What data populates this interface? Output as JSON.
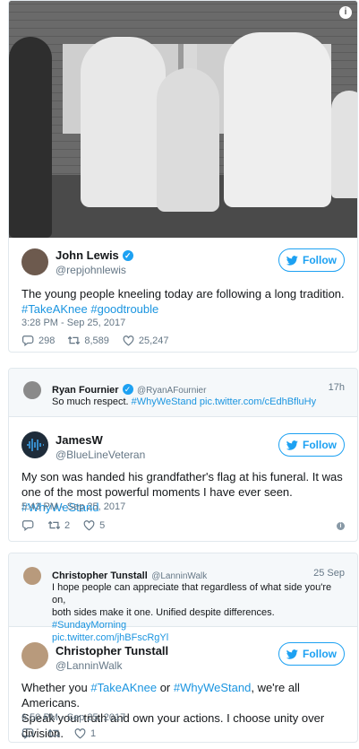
{
  "colors": {
    "accent": "#1da1f2",
    "link": "#1b95e0",
    "muted": "#657786",
    "border": "#e1e8ed"
  },
  "embed1": {
    "author": {
      "name": "John Lewis",
      "handle": "@repjohnlewis",
      "verified": true
    },
    "follow_label": "Follow",
    "text_before": "The young people kneeling today are following a long tradition.",
    "hashtags": [
      "#TakeAKnee",
      "#goodtrouble"
    ],
    "timestamp": "3:28 PM - Sep 25, 2017",
    "stats": {
      "replies": "298",
      "retweets": "8,589",
      "likes": "25,247"
    }
  },
  "embed2": {
    "quoted": {
      "author": {
        "name": "Ryan Fournier",
        "handle": "@RyanAFournier",
        "verified": true
      },
      "time": "17h",
      "text": "So much respect.",
      "hashtag": "#WhyWeStand",
      "link": "pic.twitter.com/cEdhBfluHy"
    },
    "author": {
      "name": "JamesW",
      "handle": "@BlueLineVeteran"
    },
    "follow_label": "Follow",
    "text_before": "My son was handed his grandfather's flag at his funeral. It was one of the most powerful moments I have ever seen.",
    "hashtag": "#WhyWeStand",
    "timestamp": "5:43 PM - Sep 25, 2017",
    "stats": {
      "retweets": "2",
      "likes": "5"
    }
  },
  "embed3": {
    "quoted": {
      "author": {
        "name": "Christopher Tunstall",
        "handle": "@LanninWalk"
      },
      "time": "25 Sep",
      "text_line1": "I hope people can appreciate that regardless of what side you're on,",
      "text_line2a": "both sides make it one. Unified despite differences.",
      "hashtag": "#SundayMorning",
      "link": "pic.twitter.com/jhBFscRgYl"
    },
    "author": {
      "name": "Christopher Tunstall",
      "handle": "@LanninWalk"
    },
    "follow_label": "Follow",
    "text_a": "Whether you",
    "hashtag1": "#TakeAKnee",
    "text_b": "or",
    "hashtag2": "#WhyWeStand",
    "text_c": ", we're all Americans.",
    "text_line2": "Speak your truth and own your actions. I choose unity over division.",
    "timestamp": "6:50 PM - Sep 25, 2017",
    "stats": {
      "likes": "1"
    }
  }
}
